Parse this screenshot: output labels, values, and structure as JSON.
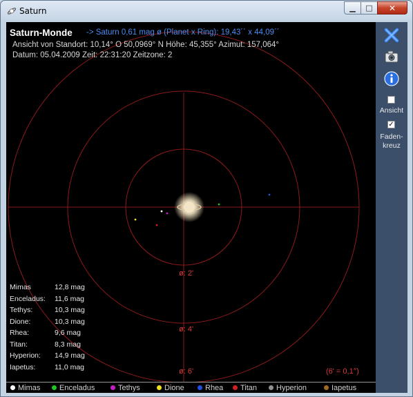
{
  "window": {
    "title": "Saturn"
  },
  "header": {
    "title": "Saturn-Monde",
    "planet_info": "-> Saturn  0,61 mag  ø (Planet x Ring): 19,43´´ x 44,09´´",
    "location": "Ansicht von Standort: 10,14° O  50,0969° N   Höhe: 45,355°  Azimut: 157,064°",
    "datetime": "Datum: 05.04.2009  Zeit: 22:31:20  Zeitzone: 2"
  },
  "rings": {
    "r1": "ø:  2'",
    "r2": "ø:  4'",
    "r3": "ø:  6'"
  },
  "scale_note": "(6' = 0,1°)",
  "moons": [
    {
      "name": "Mimas",
      "mag": "12,8 mag",
      "color": "#ffffff"
    },
    {
      "name": "Enceladus:",
      "mag": "11,6 mag",
      "color": "#22c422"
    },
    {
      "name": "Tethys:",
      "mag": "10,3 mag",
      "color": "#c020c0"
    },
    {
      "name": "Dione:",
      "mag": "10,3 mag",
      "color": "#f0e020"
    },
    {
      "name": "Rhea:",
      "mag": "9,6 mag",
      "color": "#2050e0"
    },
    {
      "name": "Titan:",
      "mag": "8,3 mag",
      "color": "#d02020"
    },
    {
      "name": "Hyperion:",
      "mag": "14,9 mag",
      "color": "#909090"
    },
    {
      "name": "Iapetus:",
      "mag": "11,0 mag",
      "color": "#a06a20"
    }
  ],
  "legend": [
    "Mimas",
    "Enceladus",
    "Tethys",
    "Dione",
    "Rhea",
    "Titan",
    "Hyperion",
    "Iapetus"
  ],
  "sidebar": {
    "view_label": "Ansicht",
    "view_checked": false,
    "crosshair_label_1": "Faden-",
    "crosshair_label_2": "kreuz",
    "crosshair_checked": true
  },
  "colors": {
    "grid": "#8e1a1a",
    "sidebar": "#3b4f6b",
    "accent_blue": "#4b8cf0"
  }
}
